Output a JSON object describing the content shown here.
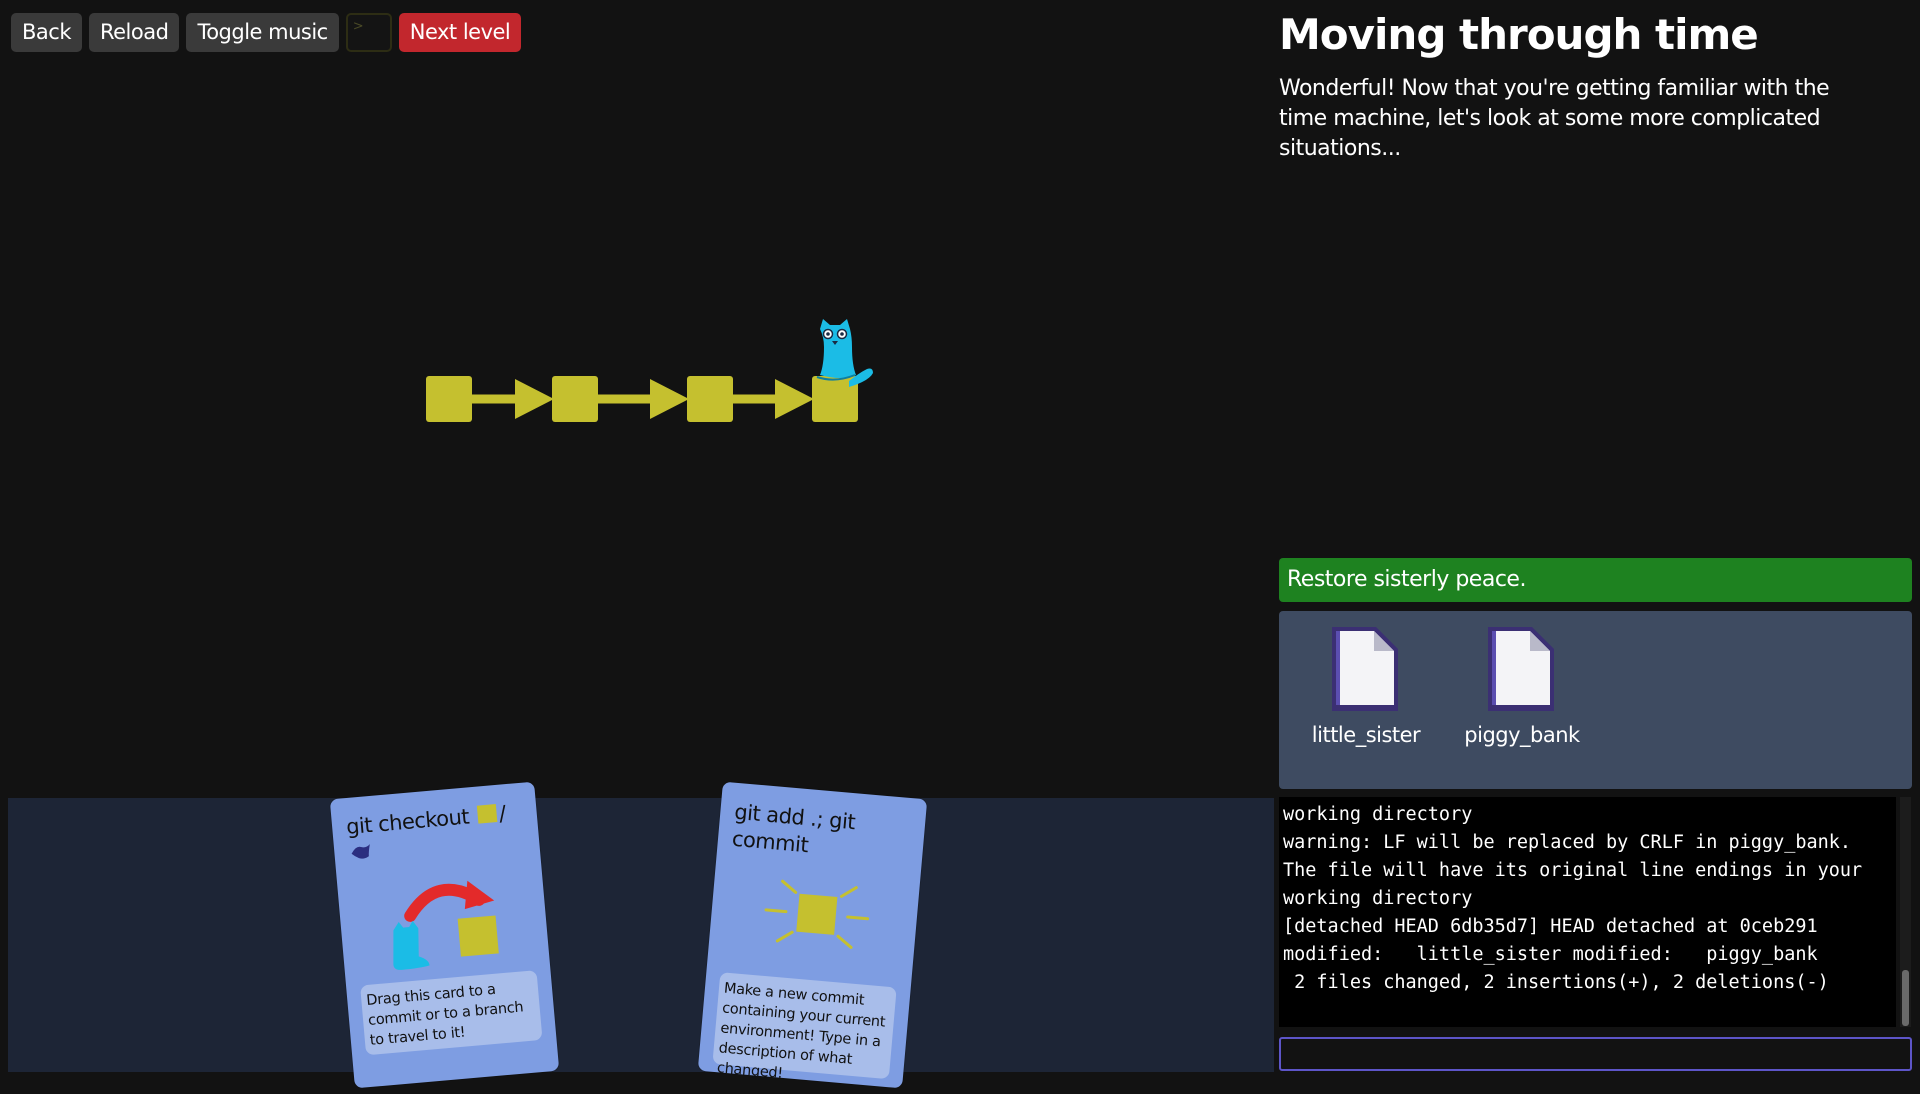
{
  "toolbar": {
    "back_label": "Back",
    "reload_label": "Reload",
    "toggle_music_label": "Toggle music",
    "terminal_glyph": ">",
    "next_level_label": "Next level"
  },
  "level": {
    "title": "Moving through time",
    "description": "Wonderful! Now that you're getting familiar with the time machine, let's look at some more complicated situations..."
  },
  "goal": {
    "text": "Restore sisterly peace."
  },
  "files": [
    {
      "name": "little_sister"
    },
    {
      "name": "piggy_bank"
    }
  ],
  "graph": {
    "commit_count": 4,
    "head_commit_index": 3,
    "commit_color": "#c5c02f",
    "head_color": "#1bbce6"
  },
  "console": {
    "lines": [
      "working directory",
      "warning: LF will be replaced by CRLF in piggy_bank.",
      "The file will have its original line endings in your",
      "working directory",
      "[detached HEAD 6db35d7] HEAD detached at 0ceb291",
      "modified:   little_sister modified:   piggy_bank",
      " 2 files changed, 2 insertions(+), 2 deletions(-)"
    ],
    "input_value": ""
  },
  "cards": [
    {
      "title": "git checkout",
      "title_suffix": "/",
      "description": "Drag this card to a commit or to a branch to travel to it!"
    },
    {
      "title": "git add .; git commit",
      "description": "Make a new commit containing your current environment! Type in a description of what changed!"
    }
  ]
}
